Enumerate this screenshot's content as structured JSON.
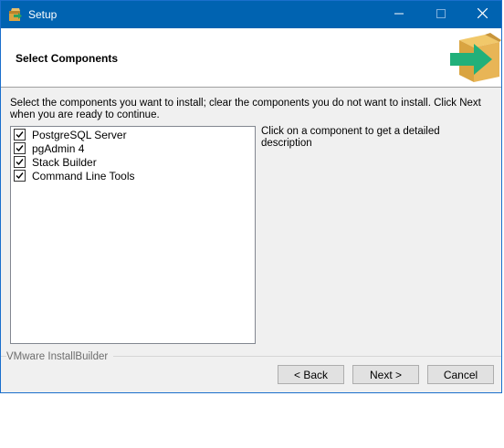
{
  "window": {
    "title": "Setup",
    "minimize_icon": "minimize-icon",
    "maximize_icon": "maximize-icon",
    "close_icon": "close-icon"
  },
  "header": {
    "title": "Select Components",
    "logo_icon": "installer-box-arrow-icon"
  },
  "instructions": "Select the components you want to install; clear the components you do not want to install. Click Next when you are ready to continue.",
  "components": [
    {
      "label": "PostgreSQL Server",
      "checked": true
    },
    {
      "label": "pgAdmin 4",
      "checked": true
    },
    {
      "label": "Stack Builder",
      "checked": true
    },
    {
      "label": "Command Line Tools",
      "checked": true
    }
  ],
  "description": "Click on a component to get a detailed description",
  "brand": "VMware InstallBuilder",
  "buttons": {
    "back": "< Back",
    "next": "Next >",
    "cancel": "Cancel"
  },
  "colors": {
    "titlebar": "#0063b1",
    "accent": "#1a6fcc"
  }
}
